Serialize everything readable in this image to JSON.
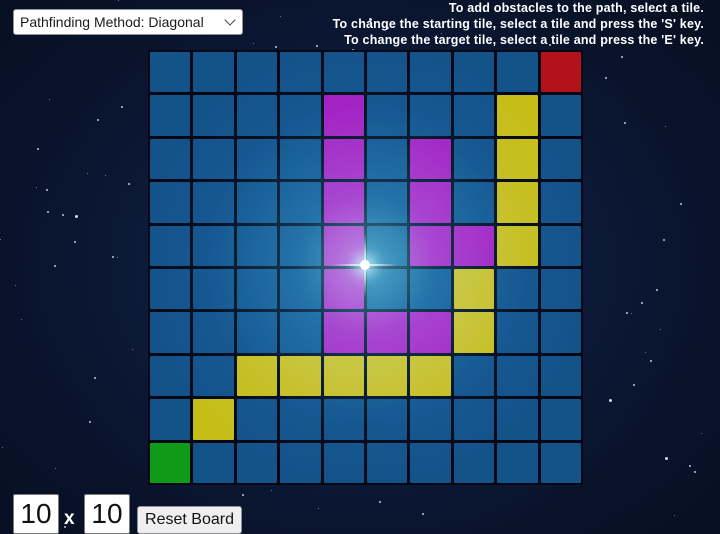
{
  "controls": {
    "method_label": "Pathfinding Method: Diagonal",
    "rows": "10",
    "cols": "10",
    "times_symbol": "x",
    "reset_label": "Reset Board"
  },
  "instructions": [
    "To add obstacles to the path, select a tile.",
    "To change the starting tile, select a tile and press the 'S' key.",
    "To change the target tile, select a tile and press the 'E' key."
  ],
  "board": {
    "size": 10,
    "legend": {
      "E": "empty",
      "P": "path",
      "V": "visited",
      "S": "start",
      "T": "target"
    },
    "rows": [
      "EEEEEEEEET",
      "EEEEVEEEPE",
      "EEEEVEVEPE",
      "EEEEVEVEPE",
      "EEEEVEVVPE",
      "EEEEVEEPEE",
      "EEEEVVVPEE",
      "EEPPPPPEEE",
      "EPEEEEEEEE",
      "SEEEEEEEEE"
    ]
  },
  "colors": {
    "empty": "#14528a",
    "path": "#c6bd17",
    "visited": "#a21cc0",
    "start": "#0f9a1a",
    "target": "#b3121c"
  }
}
